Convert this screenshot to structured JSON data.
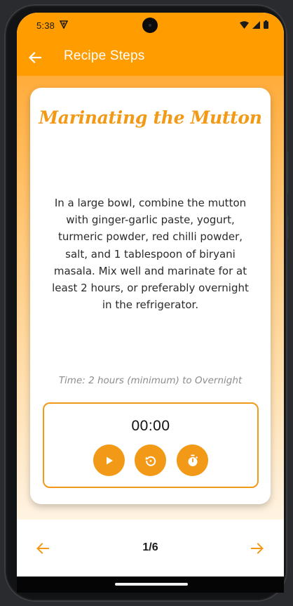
{
  "status_bar": {
    "time": "5:38",
    "icons": [
      "notification-shield-icon",
      "wifi-icon",
      "signal-icon",
      "battery-icon"
    ]
  },
  "app_bar": {
    "title": "Recipe Steps",
    "back_icon": "arrow-back-icon"
  },
  "step": {
    "title": "Marinating the Mutton",
    "description": "In a large bowl, combine the mutton with ginger-garlic paste, yogurt, turmeric powder, red chilli powder, salt, and 1 tablespoon of biryani masala. Mix well and marinate for at least 2 hours, or preferably overnight in the refrigerator.",
    "time": "Time: 2 hours (minimum) to Overnight"
  },
  "timer": {
    "display": "00:00",
    "buttons": [
      "play-icon",
      "reset-icon",
      "stopwatch-icon"
    ]
  },
  "pagination": {
    "indicator": "1/6",
    "prev_icon": "arrow-left-icon",
    "next_icon": "arrow-right-icon"
  },
  "colors": {
    "accent": "#ff9c00",
    "title_orange": "#f29a17",
    "status_bar": "#ff9c00",
    "card_bg": "#ffffff"
  }
}
